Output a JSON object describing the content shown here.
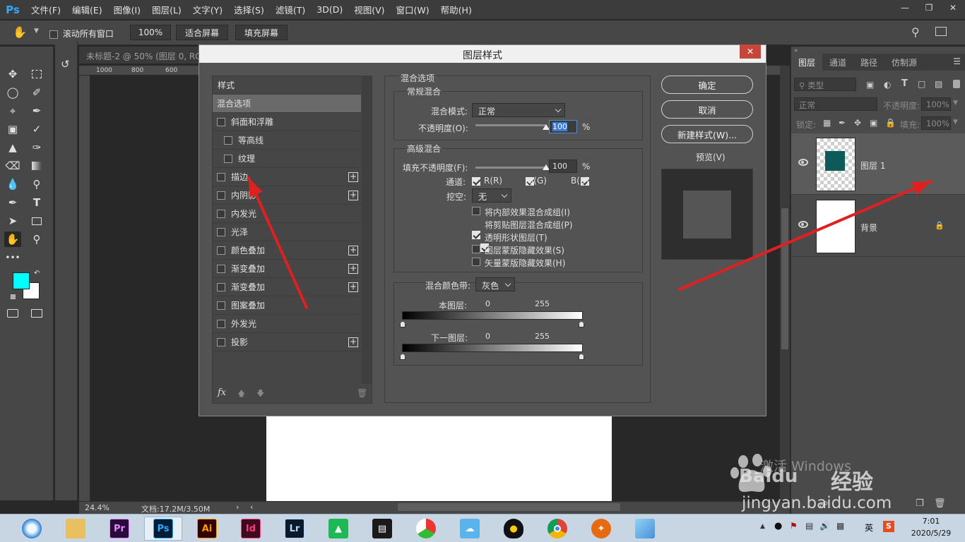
{
  "app": {
    "logo": "Ps",
    "menu": [
      "文件(F)",
      "编辑(E)",
      "图像(I)",
      "图层(L)",
      "文字(Y)",
      "选择(S)",
      "滤镜(T)",
      "3D(D)",
      "视图(V)",
      "窗口(W)",
      "帮助(H)"
    ]
  },
  "options_bar": {
    "scroll_all_label": "滚动所有窗口",
    "zoom_value": "100%",
    "fit_screen": "适合屏幕",
    "fill_screen": "填充屏幕"
  },
  "document": {
    "tab_title": "未标题-2 @ 50% (图层 0, RG",
    "ruler_marks": [
      "1000",
      "800",
      "600"
    ],
    "zoom": "24.4%",
    "doc_info": "文档:17.2M/3.50M"
  },
  "dialog": {
    "title": "图层样式",
    "styles_header": "样式",
    "styles": [
      {
        "label": "混合选项",
        "checkbox": false,
        "plus": false,
        "indent": false,
        "selected": true
      },
      {
        "label": "斜面和浮雕",
        "checkbox": true,
        "plus": false,
        "indent": false,
        "selected": false
      },
      {
        "label": "等高线",
        "checkbox": true,
        "plus": false,
        "indent": true,
        "selected": false
      },
      {
        "label": "纹理",
        "checkbox": true,
        "plus": false,
        "indent": true,
        "selected": false
      },
      {
        "label": "描边",
        "checkbox": true,
        "plus": true,
        "indent": false,
        "selected": false
      },
      {
        "label": "内阴影",
        "checkbox": true,
        "plus": true,
        "indent": false,
        "selected": false
      },
      {
        "label": "内发光",
        "checkbox": true,
        "plus": false,
        "indent": false,
        "selected": false
      },
      {
        "label": "光泽",
        "checkbox": true,
        "plus": false,
        "indent": false,
        "selected": false
      },
      {
        "label": "颜色叠加",
        "checkbox": true,
        "plus": true,
        "indent": false,
        "selected": false
      },
      {
        "label": "渐变叠加",
        "checkbox": true,
        "plus": true,
        "indent": false,
        "selected": false
      },
      {
        "label": "渐变叠加",
        "checkbox": true,
        "plus": true,
        "indent": false,
        "selected": false
      },
      {
        "label": "图案叠加",
        "checkbox": true,
        "plus": false,
        "indent": false,
        "selected": false
      },
      {
        "label": "外发光",
        "checkbox": true,
        "plus": false,
        "indent": false,
        "selected": false
      },
      {
        "label": "投影",
        "checkbox": true,
        "plus": true,
        "indent": false,
        "selected": false
      }
    ],
    "fx_label": "fx",
    "blend_options": {
      "section_title": "混合选项",
      "general_title": "常规混合",
      "blend_mode_label": "混合模式:",
      "blend_mode_value": "正常",
      "opacity_label": "不透明度(O):",
      "opacity_value": "100",
      "opacity_fraction": 1.0,
      "percent": "%",
      "advanced_title": "高级混合",
      "fill_opacity_label": "填充不透明度(F):",
      "fill_opacity_value": "100",
      "fill_opacity_fraction": 1.0,
      "channels_label": "通道:",
      "channel_r": "R(R)",
      "channel_g": "G(G)",
      "channel_b": "B(B)",
      "knockout_label": "挖空:",
      "knockout_value": "无",
      "checkbox_options": [
        {
          "label": "将内部效果混合成组(I)",
          "checked": false
        },
        {
          "label": "将剪贴图层混合成组(P)",
          "checked": true
        },
        {
          "label": "透明形状图层(T)",
          "checked": true
        },
        {
          "label": "图层蒙版隐藏效果(S)",
          "checked": false
        },
        {
          "label": "矢量蒙版隐藏效果(H)",
          "checked": false
        }
      ],
      "blend_if_label": "混合颜色带:",
      "blend_if_value": "灰色",
      "this_layer_label": "本图层:",
      "underlying_label": "下一图层:",
      "range_min": "0",
      "range_max": "255"
    },
    "buttons": {
      "ok": "确定",
      "cancel": "取消",
      "new_style": "新建样式(W)...",
      "preview": "预览(V)"
    }
  },
  "layers_panel": {
    "tabs": [
      "图层",
      "通道",
      "路径",
      "仿制源"
    ],
    "filter_placeholder": "类型",
    "blend_mode": "正常",
    "opacity_label": "不透明度:",
    "opacity_value": "100%",
    "lock_label": "锁定:",
    "fill_label": "填充:",
    "fill_value": "100%",
    "layers": [
      {
        "name": "图层 1"
      },
      {
        "name": "背景"
      }
    ]
  },
  "taskbar": {
    "apps": [
      "Pr",
      "Ps",
      "Ai",
      "Id",
      "Lr"
    ],
    "ime": "英",
    "time": "7:01",
    "date": "2020/5/29"
  },
  "watermark": {
    "activate": "激活 Windows",
    "site": "jingyan.baidu.com",
    "brand": "经验",
    "baidu": "Baidu"
  },
  "colors": {
    "foreground": "#00ffff",
    "background": "#ffffff",
    "annotation_arrow": "#e02020",
    "ps_blue": "#31a8ff"
  }
}
